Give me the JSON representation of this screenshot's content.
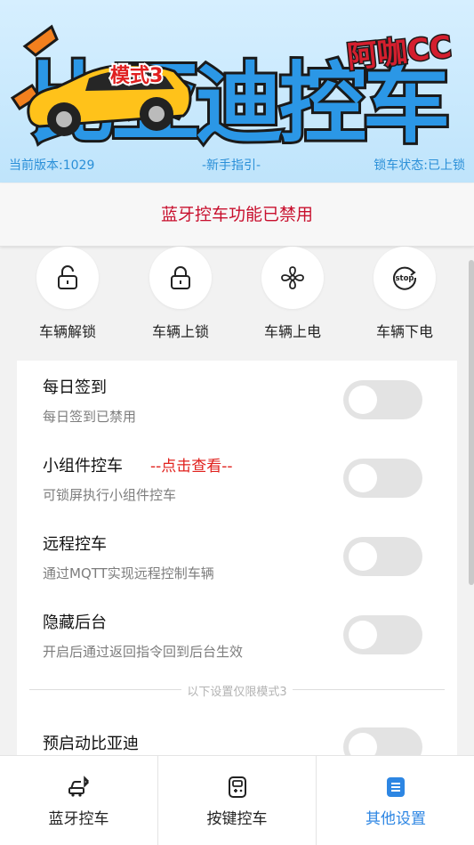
{
  "header": {
    "logo_main": "比亚迪控车",
    "logo_badge": "模式3",
    "logo_brand": "阿咖CC",
    "version_text": "当前版本:1029",
    "guide_link": "-新手指引-",
    "lock_status": "锁车状态:已上锁",
    "colors": {
      "info_text": "#2a8fd8",
      "logo_fill": "#2b97e6"
    }
  },
  "notice": {
    "text": "蓝牙控车功能已禁用",
    "color": "#c8102e"
  },
  "actions": [
    {
      "label": "车辆解锁",
      "icon": "unlock-icon"
    },
    {
      "label": "车辆上锁",
      "icon": "lock-icon"
    },
    {
      "label": "车辆上电",
      "icon": "fan-icon"
    },
    {
      "label": "车辆下电",
      "icon": "stop-icon",
      "icon_text": "stop"
    }
  ],
  "settings": [
    {
      "title": "每日签到",
      "desc": "每日签到已禁用",
      "enabled": false
    },
    {
      "title": "小组件控车",
      "link": "--点击查看--",
      "desc": "可锁屏执行小组件控车",
      "enabled": false
    },
    {
      "title": "远程控车",
      "desc": "通过MQTT实现远程控制车辆",
      "enabled": false
    },
    {
      "title": "隐藏后台",
      "desc": "开启后通过返回指令回到后台生效",
      "enabled": false
    }
  ],
  "mode_divider": "以下设置仅限模式3",
  "mode_settings": [
    {
      "title": "预启动比亚迪",
      "desc": "",
      "enabled": false
    }
  ],
  "bottom_nav": {
    "items": [
      {
        "label": "蓝牙控车",
        "icon": "car-bluetooth-icon",
        "active": false
      },
      {
        "label": "按键控车",
        "icon": "remote-key-icon",
        "active": false
      },
      {
        "label": "其他设置",
        "icon": "document-icon",
        "active": true
      }
    ],
    "active_color": "#2d86e3"
  }
}
